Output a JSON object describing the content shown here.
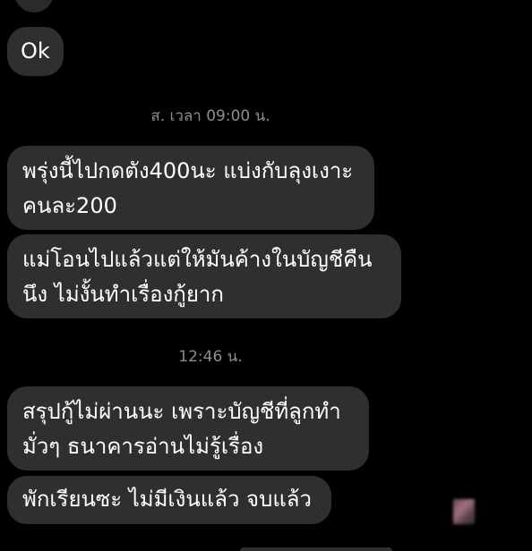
{
  "messages": [
    {
      "id": "ok",
      "lines": [
        "Ok"
      ]
    },
    {
      "id": "m1",
      "lines": [
        "พรุ่งนี้ไปกดตัง400นะ แบ่งกับลุงเงาะ",
        "คนละ200"
      ]
    },
    {
      "id": "m2",
      "lines": [
        "แม่โอนไปแล้วแต่ให้มันค้างในบัญชีคืน",
        "นึง ไม่งั้นทำเรื่องกู้ยาก"
      ]
    },
    {
      "id": "m3",
      "lines": [
        "สรุปกู้ไม่ผ่านนะ เพราะบัญชีที่ลูกทำ",
        "มั่วๆ ธนาคารอ่านไม่รู้เรื่อง"
      ]
    },
    {
      "id": "m4",
      "lines": [
        "พักเรียนซะ ไม่มีเงินแล้ว จบแล้ว"
      ]
    }
  ],
  "timestamps": {
    "first": "ส. เวลา 09:00 น.",
    "second": "12:46 น."
  },
  "colors": {
    "background": "#000000",
    "bubble": "#2f2f2f",
    "text": "#ffffff",
    "timestamp": "#8e8e8e"
  }
}
